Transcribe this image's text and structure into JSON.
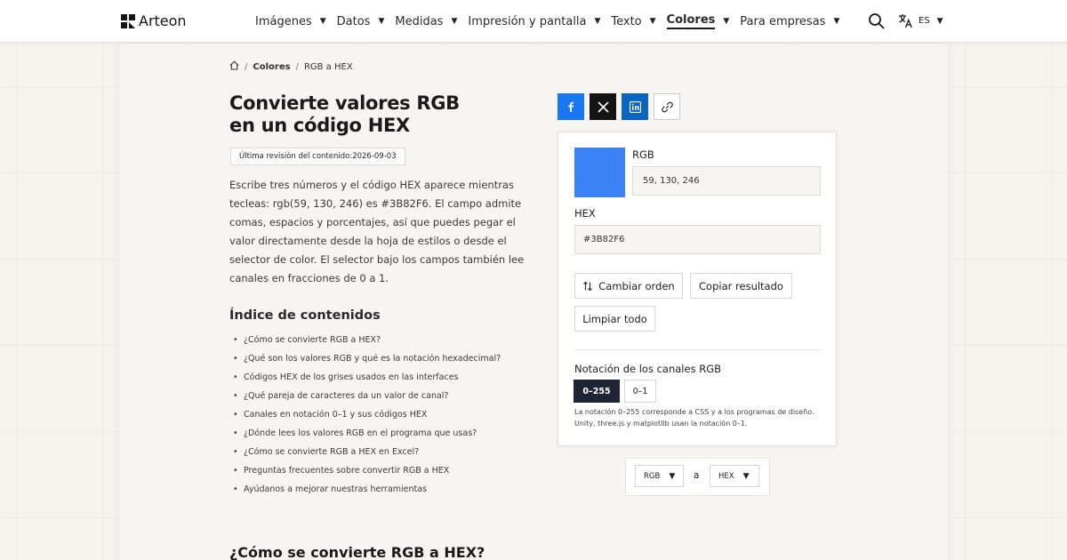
{
  "header": {
    "brand": "Arteon",
    "nav": [
      {
        "label": "Imágenes",
        "active": false
      },
      {
        "label": "Datos",
        "active": false
      },
      {
        "label": "Medidas",
        "active": false
      },
      {
        "label": "Impresión y pantalla",
        "active": false
      },
      {
        "label": "Texto",
        "active": false
      },
      {
        "label": "Colores",
        "active": true
      },
      {
        "label": "Para empresas",
        "active": false
      }
    ],
    "language": "ES",
    "icons": {
      "search": "search-icon",
      "translate": "translate-icon",
      "caret": "caret-down-icon"
    }
  },
  "breadcrumb": {
    "home_icon": "home-icon",
    "separator": "/",
    "items": [
      "Colores",
      "RGB a HEX"
    ]
  },
  "article": {
    "title": "Convierte valores RGB en un código HEX",
    "title_line1": "Convierte valores RGB",
    "title_line2": "en un código HEX",
    "revision_label": "Última revisión del contenido:",
    "revision_date": "2026-09-03",
    "intro": "Escribe tres números y el código HEX aparece mientras tecleas: rgb(59, 130, 246) es #3B82F6. El campo admite comas, espacios y porcentajes, así que puedes pegar el valor directamente desde la hoja de estilos o desde el selector de color. El selector bajo los campos también lee canales en fracciones de 0 a 1.",
    "toc_title": "Índice de contenidos",
    "toc": [
      "¿Cómo se convierte RGB a HEX?",
      "¿Qué son los valores RGB y qué es la notación hexadecimal?",
      "Códigos HEX de los grises usados en las interfaces",
      "¿Qué pareja de caracteres da un valor de canal?",
      "Canales en notación 0–1 y sus códigos HEX",
      "¿Dónde lees los valores RGB en el programa que usas?",
      "¿Cómo se convierte RGB a HEX en Excel?",
      "Preguntas frecuentes sobre convertir RGB a HEX",
      "Ayúdanos a mejorar nuestras herramientas"
    ],
    "section_title": "¿Cómo se convierte RGB a HEX?"
  },
  "share": {
    "icons": [
      "facebook-icon",
      "x-icon",
      "linkedin-icon",
      "link-icon"
    ],
    "colors": {
      "facebook": "#1877f2",
      "x": "#141414",
      "linkedin": "#0a66c2"
    }
  },
  "converter": {
    "swatch_color": "#3B82F6",
    "rgb_label": "RGB",
    "rgb_value": "59, 130, 246",
    "hex_label": "HEX",
    "hex_value": "#3B82F6",
    "swap_label": "Cambiar orden",
    "swap_icon": "swap-vertical-icon",
    "copy_label": "Copiar resultado",
    "clear_label": "Limpiar todo",
    "notation_label": "Notación de los canales RGB",
    "notation_options": [
      "0–255",
      "0–1"
    ],
    "notation_selected": "0–255",
    "notation_note": "La notación 0–255 corresponde a CSS y a los programas de diseño. Unity, three.js y matplotlib usan la notación 0–1."
  },
  "selector": {
    "from": "RGB",
    "connector": "a",
    "to": "HEX"
  },
  "colors": {
    "accent_dark": "#1e2433",
    "background": "#f6f3ef",
    "panel": "#f7f5f2"
  }
}
